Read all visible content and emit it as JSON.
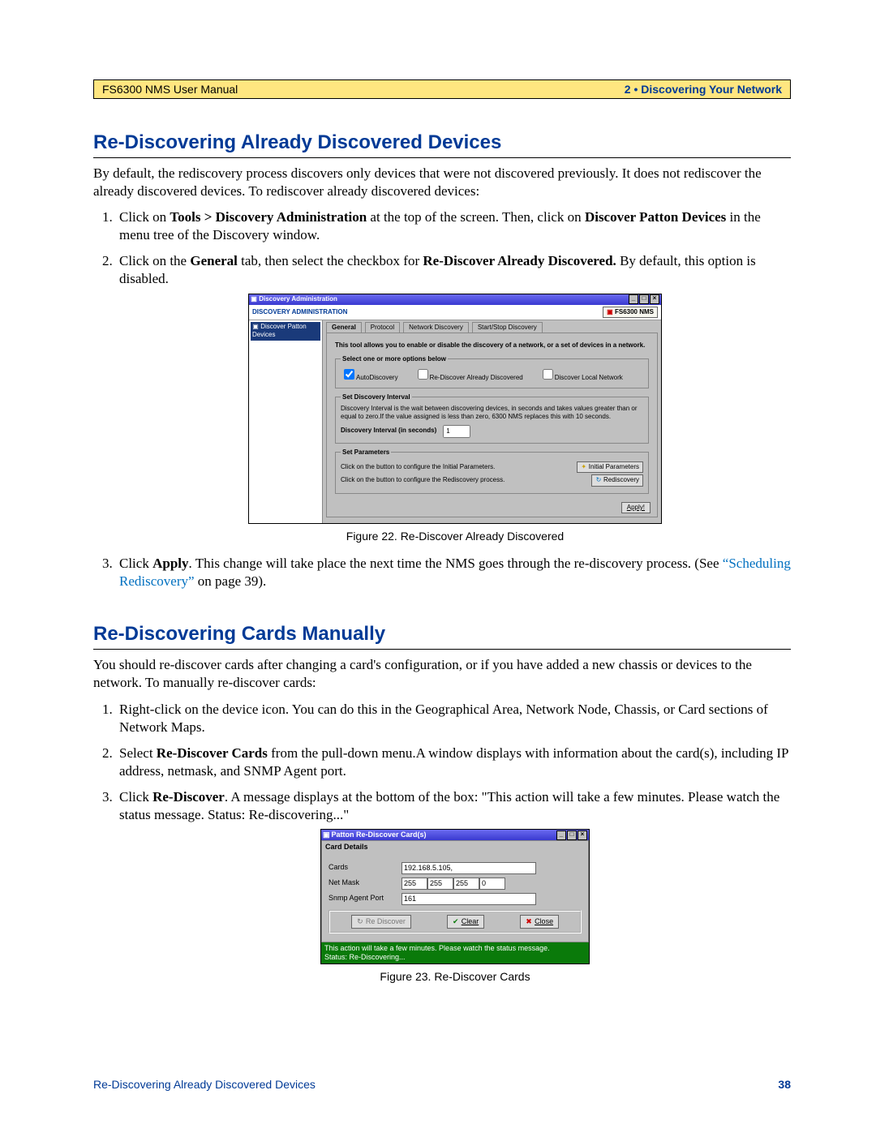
{
  "header": {
    "left": "FS6300 NMS User Manual",
    "right": "2 • Discovering Your Network"
  },
  "section1": {
    "title": "Re-Discovering Already Discovered Devices",
    "intro": "By default, the rediscovery process discovers only devices that were not discovered previously. It does not rediscover the already discovered devices. To rediscover already discovered devices:",
    "step1_a": "Click on ",
    "step1_b": "Tools > Discovery Administration",
    "step1_c": " at the top of the screen. Then, click on ",
    "step1_d": "Discover Patton Devices",
    "step1_e": " in the menu tree of the Discovery window.",
    "step2_a": "Click on the ",
    "step2_b": "General",
    "step2_c": " tab, then select the checkbox for ",
    "step2_d": "Re-Discover Already Discovered.",
    "step2_e": " By default, this option is disabled.",
    "caption1": "Figure 22. Re-Discover Already Discovered",
    "step3_a": "Click ",
    "step3_b": "Apply",
    "step3_c": ". This change will take place the next time the NMS goes through the re-discovery process. (See ",
    "step3_link": "“Scheduling Rediscovery”",
    "step3_d": " on page 39)."
  },
  "fig22": {
    "title": "Discovery Administration",
    "admin_header": "DISCOVERY ADMINISTRATION",
    "logo": "FS6300 NMS",
    "tree_node": "Discover Patton Devices",
    "tabs": [
      "General",
      "Protocol",
      "Network Discovery",
      "Start/Stop Discovery"
    ],
    "desc": "This tool allows you to enable or disable the discovery of a network, or a set of devices in a network.",
    "opts_legend": "Select one or more options below",
    "opt1": "AutoDiscovery",
    "opt2": "Re-Discover Already Discovered",
    "opt3": "Discover Local Network",
    "interval_legend": "Set Discovery Interval",
    "interval_desc": "Discovery Interval is the wait between discovering devices, in seconds and takes values greater than or equal to zero.If the value assigned is less than zero, 6300 NMS replaces this with 10 seconds.",
    "interval_label": "Discovery Interval (in seconds)",
    "interval_value": "1",
    "params_legend": "Set Parameters",
    "params1_text": "Click on the button to configure the Initial Parameters.",
    "params1_btn": "Initial Parameters",
    "params2_text": "Click on the button to configure the Rediscovery process.",
    "params2_btn": "Rediscovery",
    "apply": "Apply!"
  },
  "section2": {
    "title": "Re-Discovering Cards Manually",
    "intro": "You should re-discover cards after changing a card's configuration, or if you have added a new chassis or devices to the network. To manually re-discover cards:",
    "step1": "Right-click on the device icon. You can do this in the Geographical Area, Network Node, Chassis, or Card sections of Network Maps.",
    "step2_a": "Select ",
    "step2_b": "Re-Discover Cards",
    "step2_c": " from the pull-down menu.A window displays with information about the card(s), including IP address, netmask, and SNMP Agent port.",
    "step3_a": "Click ",
    "step3_b": "Re-Discover",
    "step3_c": ". A message displays at the bottom of the box: \"This action will take a few minutes. Please watch the status message. Status: Re-discovering...\"",
    "caption2": "Figure 23. Re-Discover Cards"
  },
  "fig23": {
    "title": "Patton Re-Discover Card(s)",
    "section_label": "Card Details",
    "cards_label": "Cards",
    "cards_value": "192.168.5.105,",
    "mask_label": "Net Mask",
    "mask_values": [
      "255",
      "255",
      "255",
      "0"
    ],
    "port_label": "Snmp Agent Port",
    "port_value": "161",
    "btn_rediscover": "Re Discover",
    "btn_clear": "Clear",
    "btn_close": "Close",
    "status_line1": "This action will take a few minutes. Please watch the status message.",
    "status_line2": "Status: Re-Discovering..."
  },
  "footer": {
    "left": "Re-Discovering Already Discovered Devices",
    "right": "38"
  }
}
